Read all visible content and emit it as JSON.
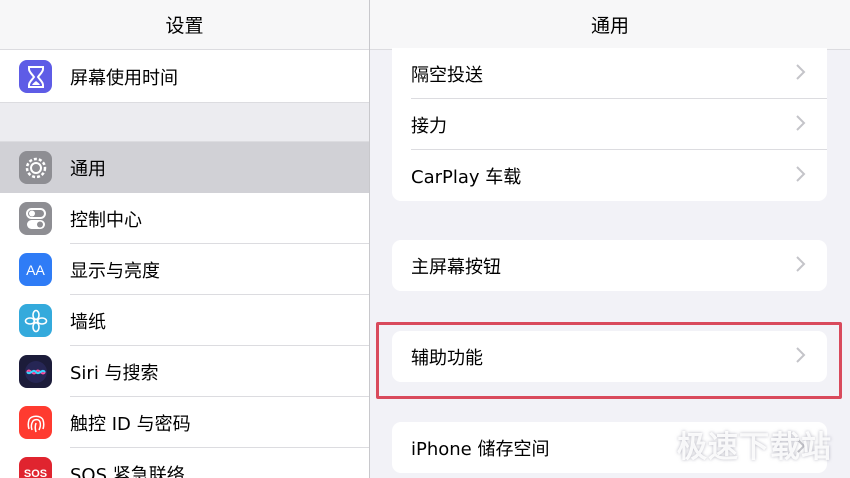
{
  "left_pane": {
    "title": "设置",
    "items": [
      {
        "label": "屏幕使用时间",
        "icon": "hourglass-icon",
        "color": "#5e5ce6"
      },
      {
        "label": "通用",
        "icon": "gear-icon",
        "color": "#8e8e93",
        "selected": true
      },
      {
        "label": "控制中心",
        "icon": "toggles-icon",
        "color": "#8e8e93"
      },
      {
        "label": "显示与亮度",
        "icon": "text-size-icon",
        "color": "#2f7cf6",
        "glyph": "AA"
      },
      {
        "label": "墙纸",
        "icon": "flower-icon",
        "color": "#34aadc"
      },
      {
        "label": "Siri 与搜索",
        "icon": "siri-icon",
        "color": "#1c1c3a"
      },
      {
        "label": "触控 ID 与密码",
        "icon": "fingerprint-icon",
        "color": "#ff3b30"
      },
      {
        "label": "SOS 紧急联络",
        "icon": "sos-icon",
        "color": "#e0242f",
        "glyph": "SOS"
      }
    ]
  },
  "right_pane": {
    "title": "通用",
    "group1": [
      {
        "label": "隔空投送"
      },
      {
        "label": "接力"
      },
      {
        "label": "CarPlay 车载"
      }
    ],
    "group2": [
      {
        "label": "主屏幕按钮"
      }
    ],
    "group3": [
      {
        "label": "辅助功能"
      }
    ],
    "group4": [
      {
        "label": "iPhone 储存空间"
      }
    ]
  },
  "highlight_color": "#d94a5c",
  "watermark": "极速下载站"
}
